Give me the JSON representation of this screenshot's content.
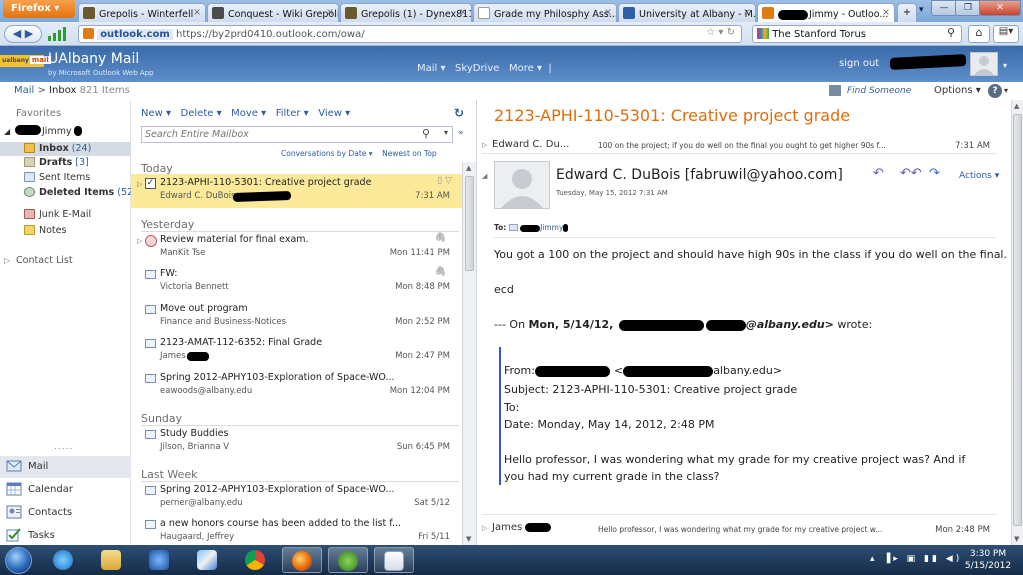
{
  "browser": {
    "menu_label": "Firefox",
    "tabs": [
      {
        "label": "Grepolis - Winterfell"
      },
      {
        "label": "Conquest - Wiki Grepolis"
      },
      {
        "label": "Grepolis (1) - Dynex811's..."
      },
      {
        "label": "Grade my Philosphy Ass..."
      },
      {
        "label": "University at Albany - M..."
      },
      {
        "label": "Jimmy - Outloo..."
      }
    ],
    "url_domain": "outlook.com",
    "url_rest": "https://by2prd0410.outlook.com/owa/",
    "search_engine_label": "The Stanford Torus",
    "new_tab": "+"
  },
  "owa": {
    "brand": "UAlbany Mail",
    "brand_sub": "by Microsoft Outlook Web App",
    "logo_text": "ualbany",
    "logo_mail": "mail",
    "nav": [
      "Mail",
      "SkyDrive",
      "More"
    ],
    "sign_out": "sign out",
    "breadcrumb_mail": "Mail",
    "breadcrumb_sep": ">",
    "breadcrumb_inbox": "Inbox",
    "breadcrumb_count": "821 Items",
    "find_someone": "Find Someone",
    "options": "Options"
  },
  "folders": {
    "favorites_label": "Favorites",
    "account_name": "Jimmy",
    "items": [
      {
        "label": "Inbox",
        "count": "(24)"
      },
      {
        "label": "Drafts",
        "count": "[3]"
      },
      {
        "label": "Sent Items",
        "count": ""
      },
      {
        "label": "Deleted Items",
        "count": "(52)"
      },
      {
        "label": "Junk E-Mail",
        "count": ""
      },
      {
        "label": "Notes",
        "count": ""
      }
    ],
    "contact_list": "Contact List",
    "dots": ".....",
    "bottom_nav": [
      "Mail",
      "Calendar",
      "Contacts",
      "Tasks"
    ]
  },
  "toolbar": {
    "new": "New",
    "delete": "Delete",
    "move": "Move",
    "filter": "Filter",
    "view": "View",
    "search_placeholder": "Search Entire Mailbox",
    "sort_by": "Conversations by Date",
    "sort_order": "Newest on Top"
  },
  "groups": [
    "Today",
    "Yesterday",
    "Sunday",
    "Last Week"
  ],
  "messages": [
    {
      "subject": "2123-APHI-110-5301: Creative project grade",
      "from": "Edward C. DuBois;",
      "date": "7:31 AM"
    },
    {
      "subject": "Review material for final exam.",
      "from": "ManKit Tse",
      "date": "Mon 11:41 PM"
    },
    {
      "subject": "FW:",
      "from": "Victoria Bennett",
      "date": "Mon 8:48 PM"
    },
    {
      "subject": "Move out program",
      "from": "Finance and Business-Notices",
      "date": "Mon 2:52 PM"
    },
    {
      "subject": "2123-AMAT-112-6352: Final Grade",
      "from": "James",
      "date": "Mon 2:47 PM"
    },
    {
      "subject": "Spring 2012-APHY103-Exploration of Space-WO...",
      "from": "eawoods@albany.edu",
      "date": "Mon 12:04 PM"
    },
    {
      "subject": "Study Buddies",
      "from": "Jilson, Brianna V",
      "date": "Sun 6:45 PM"
    },
    {
      "subject": "Spring 2012-APHY103-Exploration of Space-WO...",
      "from": "perner@albany.edu",
      "date": "Sat 5/12"
    },
    {
      "subject": "a new honors course has been added to the list f...",
      "from": "Haugaard, Jeffrey",
      "date": "Fri 5/11"
    }
  ],
  "reading": {
    "title": "2123-APHI-110-5301: Creative project grade",
    "thread_top_from": "Edward C. Du...",
    "thread_top_snippet": "100 on the project; if you do well on the final you ought to get higher 90s f...",
    "thread_top_time": "7:31 AM",
    "sender": "Edward C. DuBois [fabruwil@yahoo.com]",
    "sent_date": "Tuesday, May 15, 2012 7:31 AM",
    "actions": "Actions",
    "to_label": "To:",
    "to_name": "Jimmy",
    "body1": "You got a 100 on the project and should have high 90s in the class if you do well on the final.",
    "body2": "ecd",
    "quote_intro_pre": "--- On ",
    "quote_intro_date": "Mon, 5/14/12,",
    "quote_intro_email": "@albany.edu>",
    "quote_intro_post": " wrote:",
    "q_from_label": "From:",
    "q_from_email": "albany.edu>",
    "q_subject": "Subject: 2123-APHI-110-5301: Creative project grade",
    "q_to": "To:",
    "q_date": "Date: Monday, May 14, 2012, 2:48 PM",
    "q_body1": "Hello professor, I was wondering what my grade for my creative project was? And if",
    "q_body2": "you had my current grade in the class?",
    "thread_bottom_from": "James",
    "thread_bottom_snippet": "Hello professor, I was wondering what my grade for my creative project w...",
    "thread_bottom_time": "Mon 2:48 PM"
  },
  "taskbar": {
    "time": "3:30 PM",
    "date": "5/15/2012"
  },
  "colors": {
    "owa_blue": "#3a6aa7",
    "title_orange": "#e36c09",
    "selected_row": "#fde99a",
    "link_blue": "#1f5fbf"
  }
}
